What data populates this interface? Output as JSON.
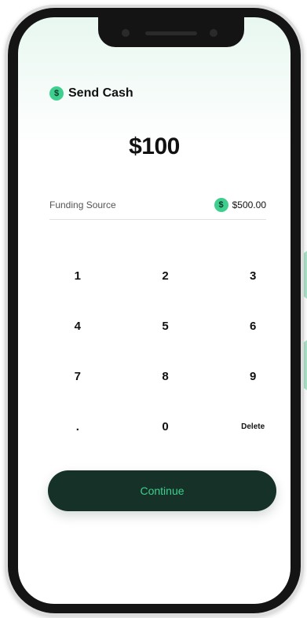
{
  "header": {
    "title": "Send Cash",
    "icon": "dollar-coin-icon",
    "icon_glyph": "$"
  },
  "amount": "$100",
  "funding": {
    "label": "Funding Source",
    "value": "$500.00",
    "icon": "dollar-coin-icon",
    "icon_glyph": "$"
  },
  "keypad": {
    "keys": [
      "1",
      "2",
      "3",
      "4",
      "5",
      "6",
      "7",
      "8",
      "9",
      ".",
      "0",
      "Delete"
    ]
  },
  "continue_label": "Continue",
  "colors": {
    "accent": "#3ecf8e",
    "button_bg": "#163128",
    "text": "#111111"
  }
}
